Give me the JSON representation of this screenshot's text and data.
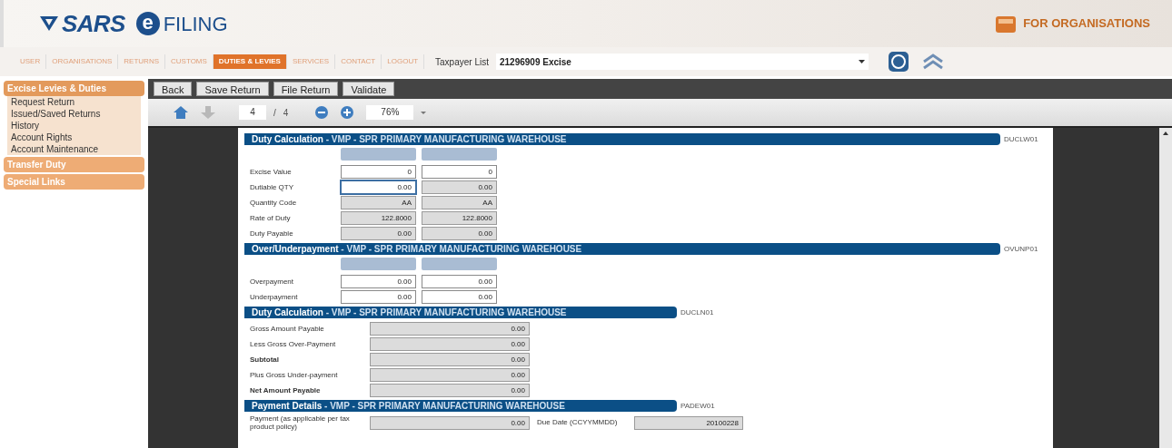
{
  "logo": {
    "brand": "SARS",
    "e": "e",
    "product": "FILING"
  },
  "audience": "FOR ORGANISATIONS",
  "nav": [
    {
      "label": "USER",
      "selected": false
    },
    {
      "label": "ORGANISATIONS",
      "selected": false
    },
    {
      "label": "RETURNS",
      "selected": false
    },
    {
      "label": "CUSTOMS",
      "selected": false
    },
    {
      "label": "DUTIES & LEVIES",
      "selected": true
    },
    {
      "label": "SERVICES",
      "selected": false
    },
    {
      "label": "CONTACT",
      "selected": false
    },
    {
      "label": "LOGOUT",
      "selected": false
    }
  ],
  "taxpayer": {
    "label": "Taxpayer List",
    "value": "21296909 Excise"
  },
  "sidebar": [
    {
      "label": "Excise Levies & Duties",
      "expanded": true,
      "children": [
        {
          "label": "Request Return"
        },
        {
          "label": "Issued/Saved Returns"
        },
        {
          "label": "History"
        },
        {
          "label": "Account Rights"
        },
        {
          "label": "Account Maintenance"
        }
      ]
    },
    {
      "label": "Transfer Duty",
      "expanded": false
    },
    {
      "label": "Special Links",
      "expanded": false
    }
  ],
  "actions": [
    "Back",
    "Save Return",
    "File Return",
    "Validate"
  ],
  "viewer": {
    "page": "4",
    "separator": "/",
    "pages": "4",
    "zoom": "76%"
  },
  "sections": [
    {
      "kind": "two-column",
      "title": "Duty Calculation",
      "subtitle": " - VMP - SPR PRIMARY MANUFACTURING WAREHOUSE",
      "code": "DUCLW01",
      "rows": [
        {
          "label": "Excise Value",
          "bold": false,
          "cells": [
            {
              "value": "0",
              "editable": true,
              "focused": false
            },
            {
              "value": "0",
              "editable": true,
              "focused": false
            }
          ]
        },
        {
          "label": "Dutiable QTY",
          "bold": false,
          "cells": [
            {
              "value": "0.00",
              "editable": false,
              "focused": true
            },
            {
              "value": "0.00",
              "editable": false,
              "focused": false
            }
          ]
        },
        {
          "label": "Quantity Code",
          "bold": false,
          "cells": [
            {
              "value": "AA",
              "editable": false,
              "focused": false
            },
            {
              "value": "AA",
              "editable": false,
              "focused": false
            }
          ]
        },
        {
          "label": "Rate of Duty",
          "bold": false,
          "cells": [
            {
              "value": "122.8000",
              "editable": false,
              "focused": false
            },
            {
              "value": "122.8000",
              "editable": false,
              "focused": false
            }
          ]
        },
        {
          "label": "Duty Payable",
          "bold": false,
          "cells": [
            {
              "value": "0.00",
              "editable": false,
              "focused": false
            },
            {
              "value": "0.00",
              "editable": false,
              "focused": false
            }
          ]
        }
      ]
    },
    {
      "kind": "two-column",
      "title": "Over/Underpayment",
      "subtitle": " - VMP - SPR PRIMARY MANUFACTURING WAREHOUSE",
      "code": "OVUNP01",
      "rows": [
        {
          "label": "Overpayment",
          "bold": false,
          "cells": [
            {
              "value": "0.00",
              "editable": true,
              "focused": false
            },
            {
              "value": "0.00",
              "editable": true,
              "focused": false
            }
          ]
        },
        {
          "label": "Underpayment",
          "bold": false,
          "cells": [
            {
              "value": "0.00",
              "editable": true,
              "focused": false
            },
            {
              "value": "0.00",
              "editable": true,
              "focused": false
            }
          ]
        }
      ]
    },
    {
      "kind": "summary",
      "title": "Duty Calculation",
      "subtitle": " - VMP - SPR PRIMARY MANUFACTURING WAREHOUSE",
      "code": "DUCLN01",
      "rows": [
        {
          "label": "Gross Amount Payable",
          "bold": false,
          "cells": [
            {
              "value": "0.00",
              "editable": false,
              "focused": false
            }
          ]
        },
        {
          "label": "Less Gross Over-Payment",
          "bold": false,
          "cells": [
            {
              "value": "0.00",
              "editable": false,
              "focused": false
            }
          ]
        },
        {
          "label": "Subtotal",
          "bold": true,
          "cells": [
            {
              "value": "0.00",
              "editable": false,
              "focused": false
            }
          ]
        },
        {
          "label": "Plus Gross Under-payment",
          "bold": false,
          "cells": [
            {
              "value": "0.00",
              "editable": false,
              "focused": false
            }
          ]
        },
        {
          "label": "Net Amount Payable",
          "bold": true,
          "cells": [
            {
              "value": "0.00",
              "editable": false,
              "focused": false
            }
          ]
        }
      ]
    },
    {
      "kind": "payment",
      "title": "Payment Details",
      "subtitle": " - VMP - SPR PRIMARY MANUFACTURING WAREHOUSE",
      "code": "PADEW01",
      "rows": [
        {
          "label": "Payment (as applicable per tax product policy)",
          "bold": false,
          "cells": [
            {
              "value": "0.00",
              "editable": false,
              "focused": false
            }
          ]
        }
      ],
      "due": {
        "label": "Due Date (CCYYMMDD)",
        "value": "20100228",
        "editable": false,
        "focused": false
      }
    }
  ]
}
